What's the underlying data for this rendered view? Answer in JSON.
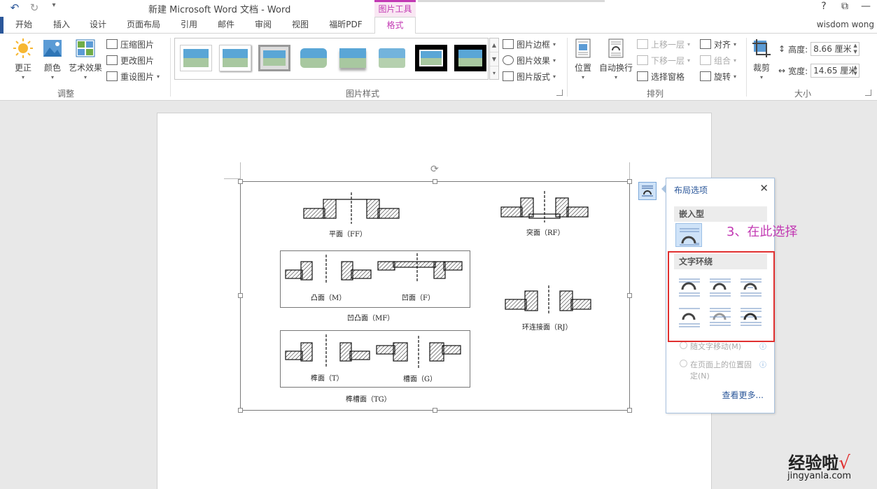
{
  "titlebar": {
    "title": "新建 Microsoft Word 文档 - Word",
    "context_tab_group": "图片工具",
    "help": "?",
    "restore": "⧉",
    "minimize": "—"
  },
  "tabs": [
    "开始",
    "插入",
    "设计",
    "页面布局",
    "引用",
    "邮件",
    "审阅",
    "视图",
    "福昕PDF",
    "格式"
  ],
  "active_tab": "格式",
  "user": "wisdom wong",
  "ribbon": {
    "adjust": {
      "label": "调整",
      "correct": "更正",
      "color": "颜色",
      "artistic": "艺术效果",
      "compress": "压缩图片",
      "change": "更改图片",
      "reset": "重设图片"
    },
    "styles": {
      "label": "图片样式",
      "border": "图片边框",
      "effects": "图片效果",
      "layout": "图片版式"
    },
    "arrange": {
      "label": "排列",
      "position": "位置",
      "wrap": "自动换行",
      "bring_forward": "上移一层",
      "send_backward": "下移一层",
      "selection_pane": "选择窗格",
      "align": "对齐",
      "group": "组合",
      "rotate": "旋转"
    },
    "size": {
      "label": "大小",
      "crop": "裁剪",
      "height_label": "高度:",
      "height_value": "8.66 厘米",
      "width_label": "宽度:",
      "width_value": "14.65 厘米"
    }
  },
  "figure": {
    "captions": {
      "ff": "平面（FF）",
      "rf": "突面（RF）",
      "m": "凸面（M）",
      "f": "凹面（F）",
      "mf": "凹凸面（MF）",
      "rj": "环连接面（RJ）",
      "t": "榫面（T）",
      "g": "槽面（G）",
      "tg": "榫槽面（TG）"
    }
  },
  "layout_popup": {
    "title": "布局选项",
    "close": "✕",
    "inline_section": "嵌入型",
    "wrap_section": "文字环绕",
    "move_with_text": "随文字移动(M)",
    "fix_position": "在页面上的位置固定(N)",
    "see_more": "查看更多..."
  },
  "annotation": "3、在此选择",
  "watermark": {
    "cn": "经验啦",
    "check": "√",
    "en": "jingyanla.com"
  },
  "colors": {
    "word_blue": "#2b579a",
    "context_magenta": "#c239b3",
    "highlight_red": "#e03030"
  }
}
